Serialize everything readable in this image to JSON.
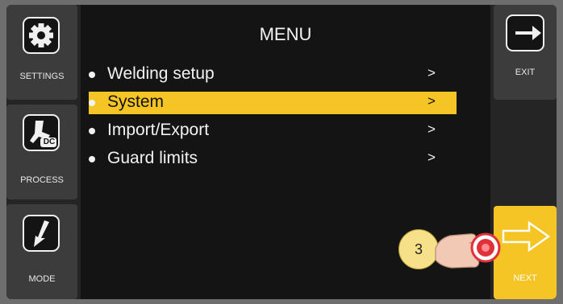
{
  "sidebar_left": {
    "settings_label": "SETTINGS",
    "process_label": "PROCESS",
    "process_badge": "DC",
    "mode_label": "MODE"
  },
  "sidebar_right": {
    "exit_label": "EXIT",
    "next_label": "NEXT"
  },
  "menu": {
    "title": "MENU",
    "items": [
      {
        "label": "Welding setup",
        "arrow": ">"
      },
      {
        "label": "System",
        "arrow": ">",
        "selected": true
      },
      {
        "label": "Import/Export",
        "arrow": ">"
      },
      {
        "label": "Guard limits",
        "arrow": ">"
      }
    ]
  },
  "annotation": {
    "step": "3"
  },
  "colors": {
    "accent": "#f5c425",
    "background": "#141414",
    "panel": "#3c3c3c",
    "press_indicator": "#e0303a"
  },
  "icons": [
    "gear-icon",
    "torch-icon",
    "mode-icon",
    "exit-arrow-icon",
    "next-arrow-icon",
    "pointing-hand-icon"
  ]
}
